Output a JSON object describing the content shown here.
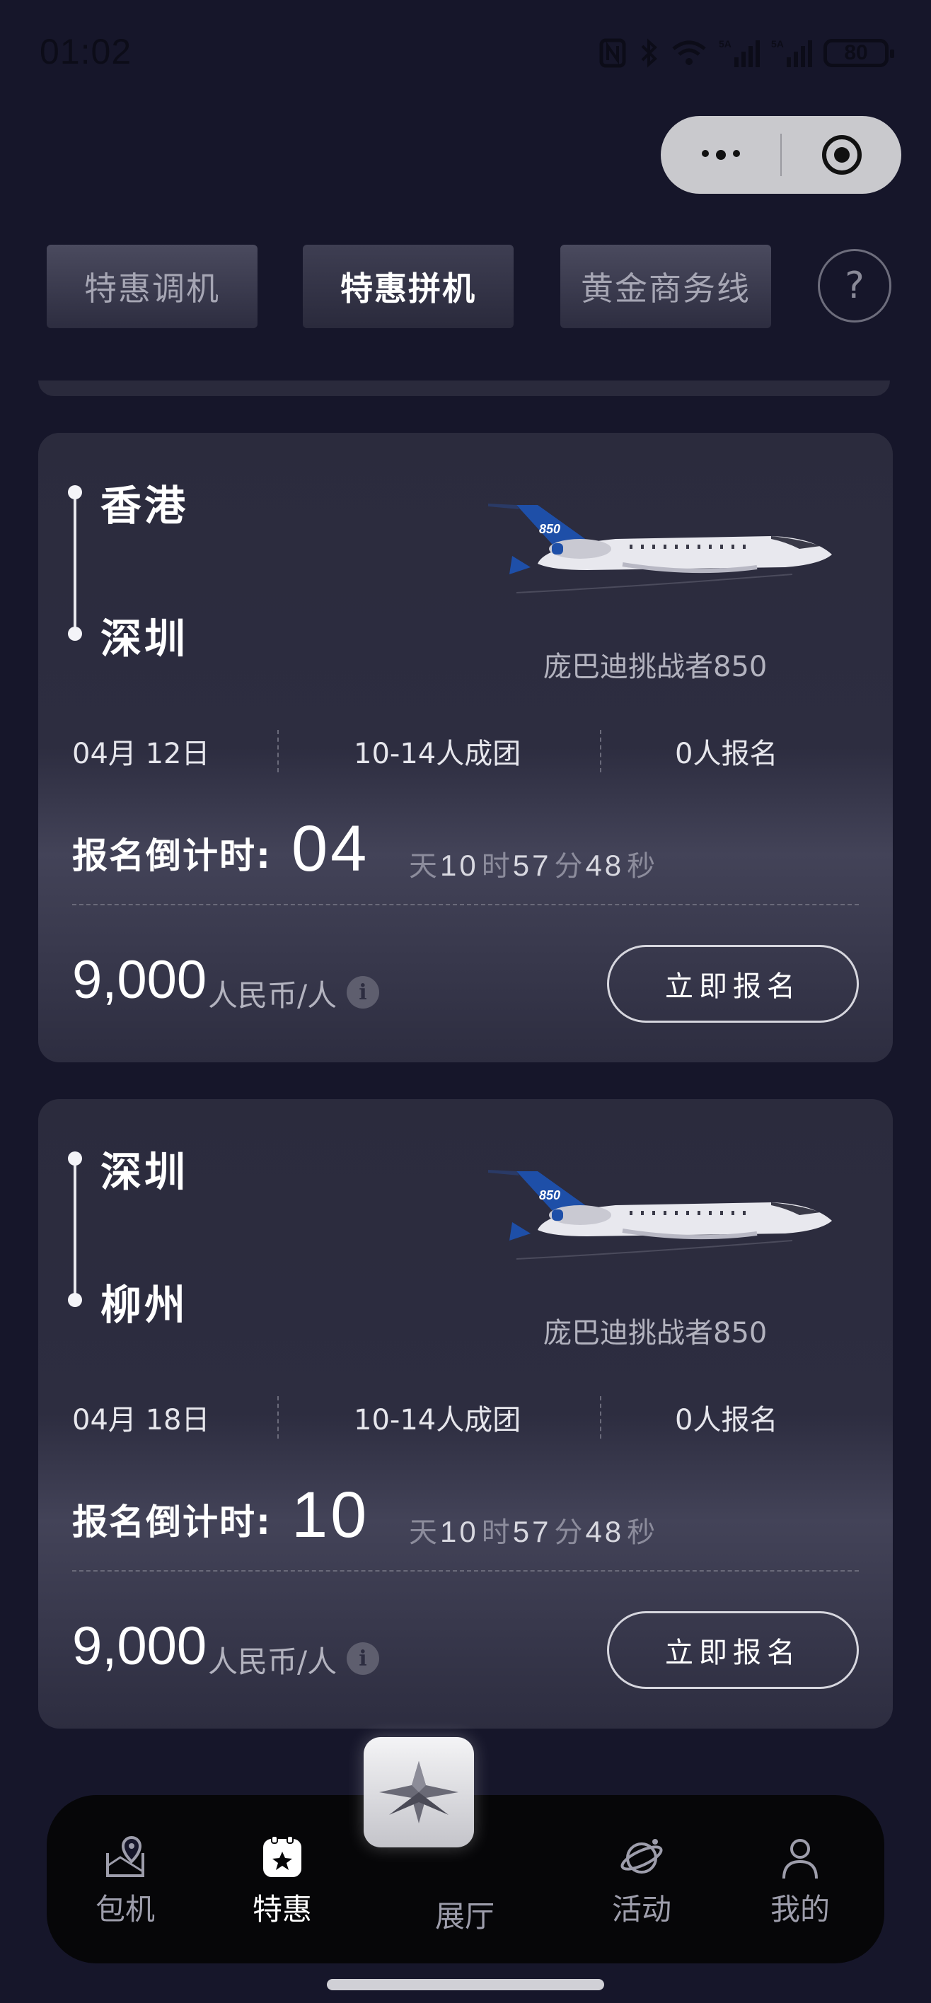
{
  "status_bar": {
    "time": "01:02",
    "battery": "80"
  },
  "tabs": [
    {
      "label": "特惠调机",
      "active": false
    },
    {
      "label": "特惠拼机",
      "active": true
    },
    {
      "label": "黄金商务线",
      "active": false
    }
  ],
  "help_label": "?",
  "flights": [
    {
      "from": "香港",
      "to": "深圳",
      "aircraft": "庞巴迪挑战者850",
      "plane_number": "850",
      "date": "04月 12日",
      "group_size": "10-14人成团",
      "signup_count": "0人报名",
      "countdown_label": "报名倒计时:",
      "days": "04",
      "day_unit": "天",
      "hours": "10",
      "hour_unit": "时",
      "minutes": "57",
      "minute_unit": "分",
      "seconds": "48",
      "second_unit": "秒",
      "price": "9,000",
      "price_unit": "人民币/人",
      "button": "立即报名"
    },
    {
      "from": "深圳",
      "to": "柳州",
      "aircraft": "庞巴迪挑战者850",
      "plane_number": "850",
      "date": "04月 18日",
      "group_size": "10-14人成团",
      "signup_count": "0人报名",
      "countdown_label": "报名倒计时:",
      "days": "10",
      "day_unit": "天",
      "hours": "10",
      "hour_unit": "时",
      "minutes": "57",
      "minute_unit": "分",
      "seconds": "48",
      "second_unit": "秒",
      "price": "9,000",
      "price_unit": "人民币/人",
      "button": "立即报名"
    }
  ],
  "tab_bar": [
    {
      "label": "包机",
      "icon": "map-pin-icon",
      "active": false
    },
    {
      "label": "特惠",
      "icon": "star-badge-icon",
      "active": true
    },
    {
      "label": "展厅",
      "icon": "logo-icon",
      "active": false
    },
    {
      "label": "活动",
      "icon": "planet-icon",
      "active": false
    },
    {
      "label": "我的",
      "icon": "user-icon",
      "active": false
    }
  ],
  "colors": {
    "background": "#16162a",
    "card": "#2d2d40",
    "accent": "#1e4fa8"
  }
}
